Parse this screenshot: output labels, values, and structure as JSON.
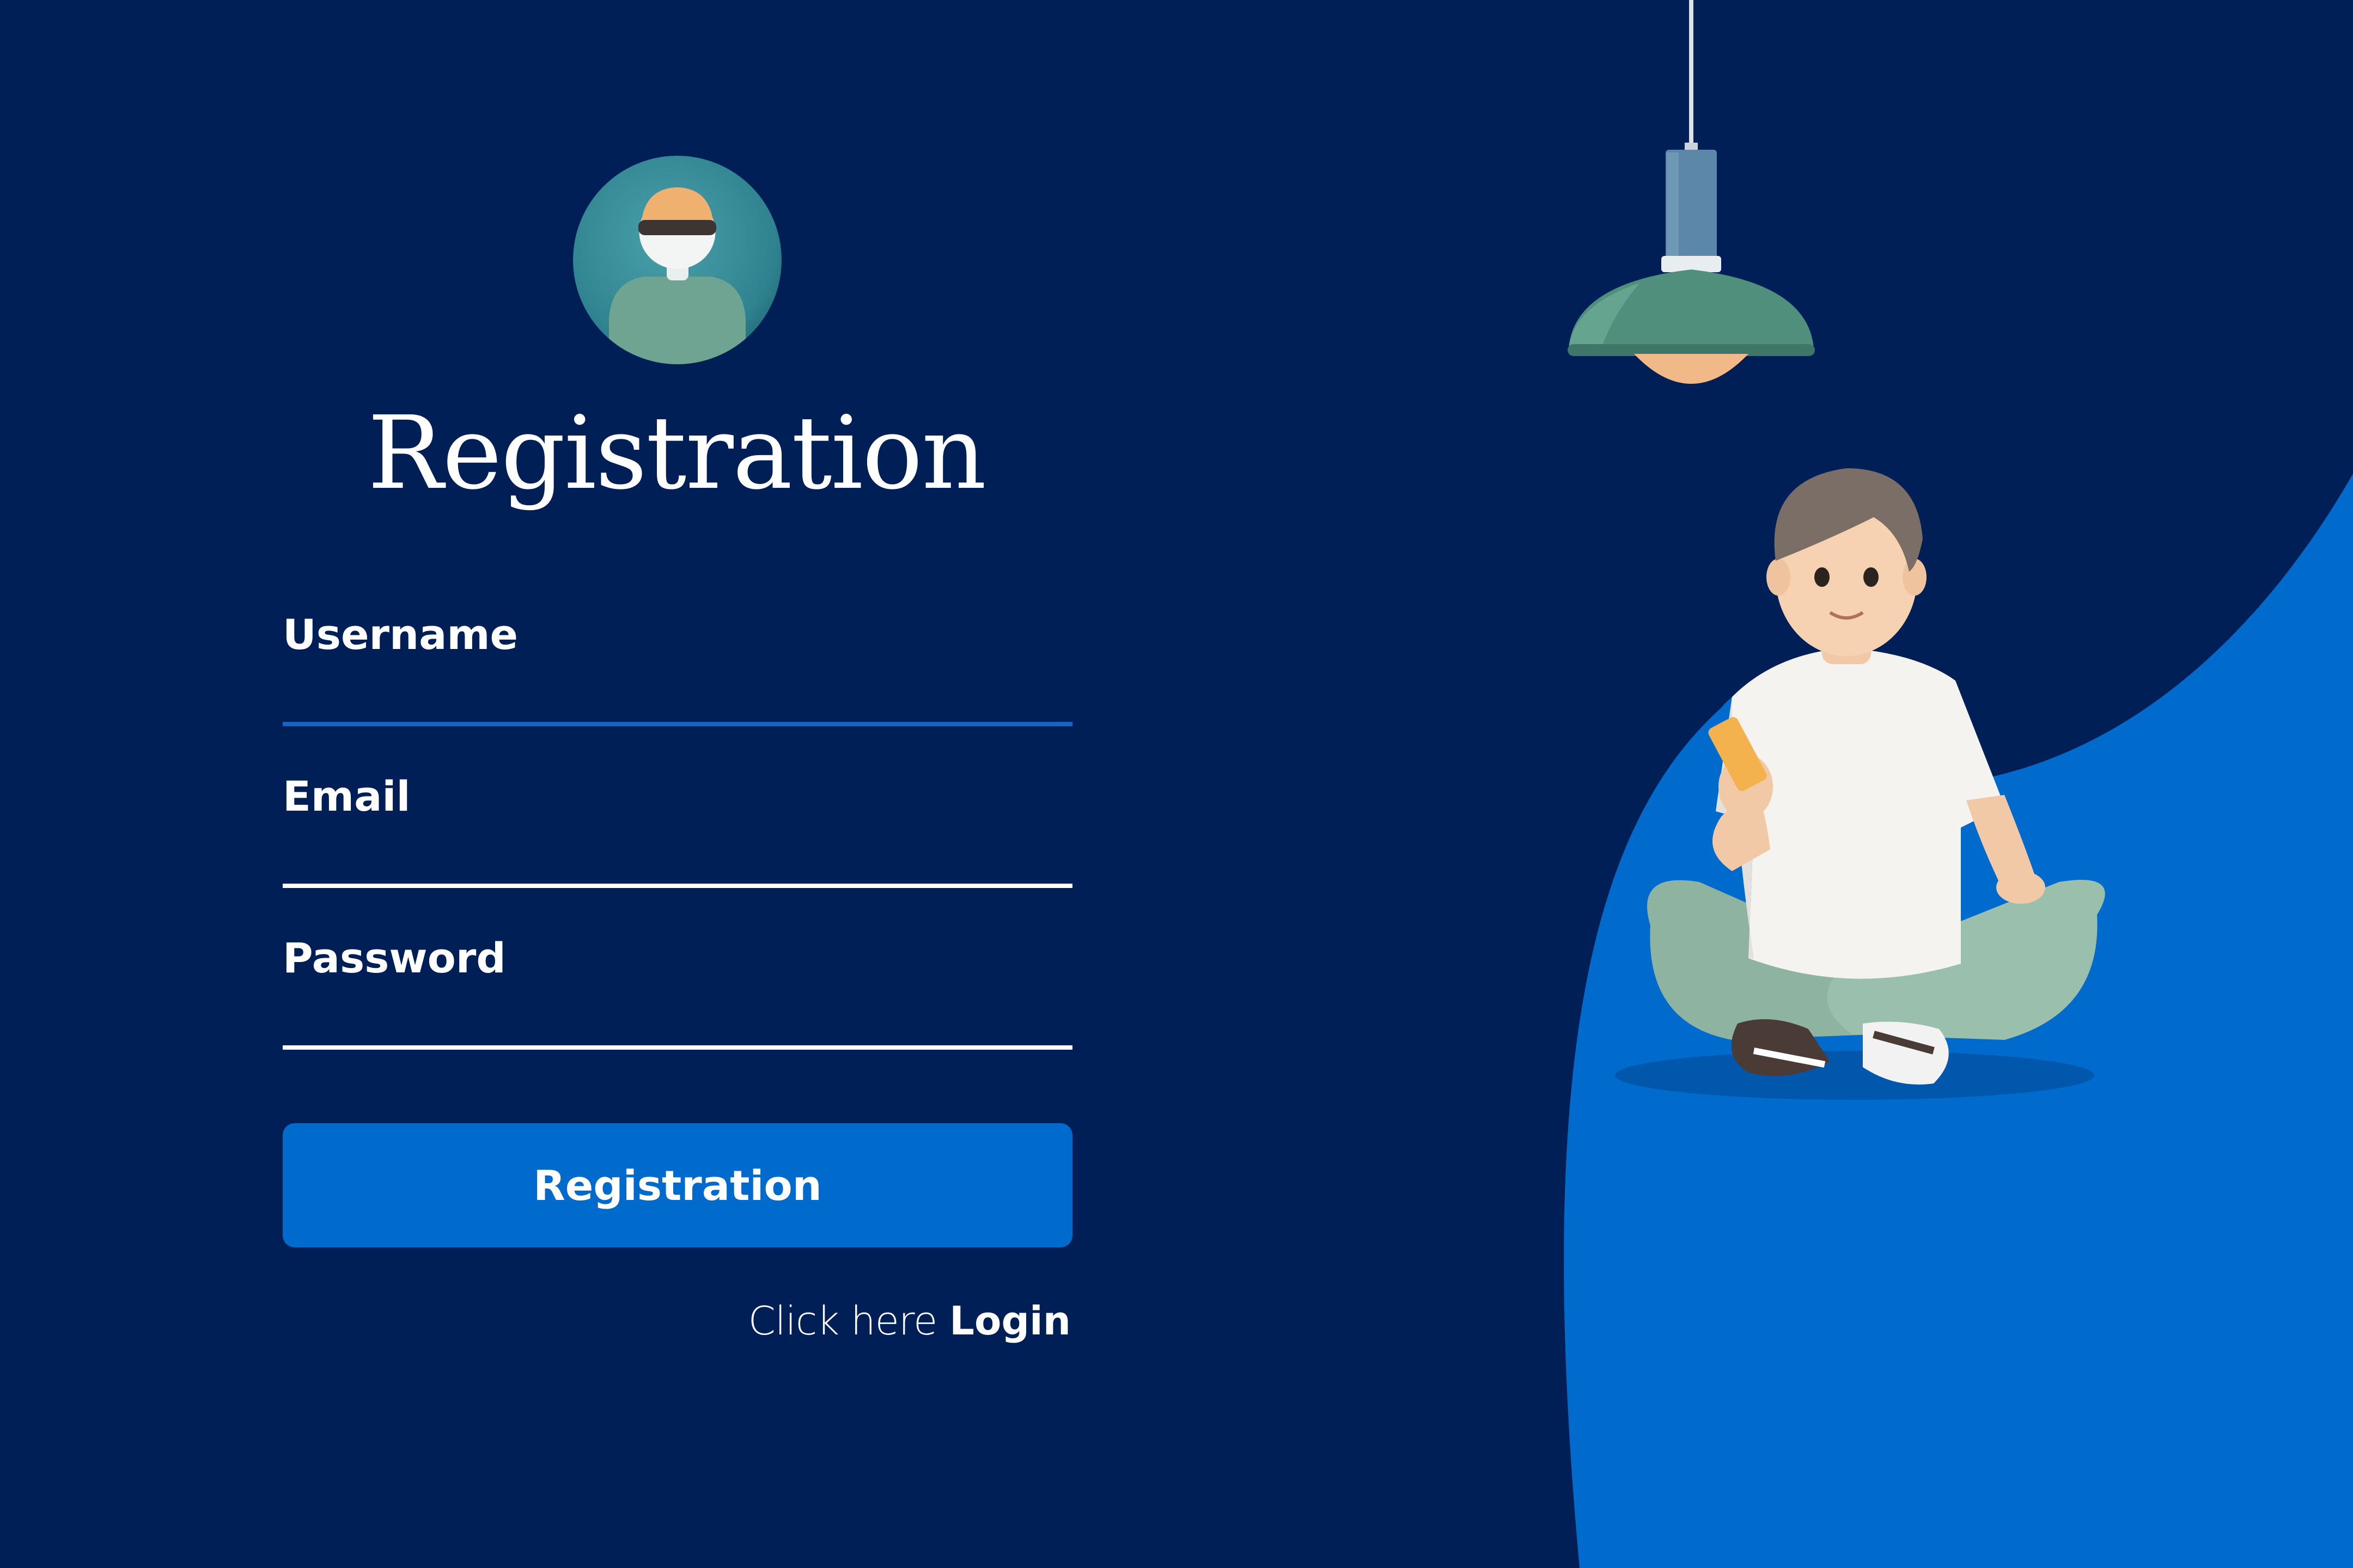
{
  "page": {
    "title": "Registration"
  },
  "form": {
    "username": {
      "label": "Username",
      "value": "",
      "placeholder": ""
    },
    "email": {
      "label": "Email",
      "value": "",
      "placeholder": ""
    },
    "password": {
      "label": "Password",
      "value": "",
      "placeholder": ""
    },
    "submit_label": "Registration"
  },
  "footer": {
    "prompt": "Click here",
    "link_label": "Login"
  },
  "icons": {
    "avatar": "user-avatar-icon",
    "lamp": "pendant-lamp-icon",
    "person": "person-with-phone-illustration"
  },
  "colors": {
    "background": "#001f57",
    "accent": "#006bcc",
    "active_underline": "#1565c9",
    "text": "#ffffff"
  }
}
